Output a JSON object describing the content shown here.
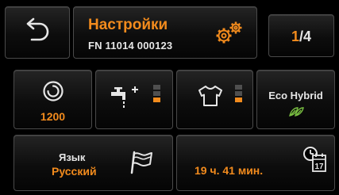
{
  "header": {
    "title": "Настройки",
    "subtitle": "FN 11014 000123",
    "back_icon": "back-arrow-icon",
    "settings_icon": "gears-icon"
  },
  "pagination": {
    "current": "1",
    "total": "/4"
  },
  "options": {
    "spin": {
      "value": "1200",
      "icon": "spin-icon"
    },
    "extra_water": {
      "icon": "tap-plus-icon",
      "level_bars_lit": 1,
      "level_bars_total": 3
    },
    "soil_level": {
      "icon": "shirt-icon",
      "level_bars_lit": 1,
      "level_bars_total": 3
    },
    "eco": {
      "label": "Eco Hybrid",
      "icon": "eco-leaf-icon"
    }
  },
  "language": {
    "label": "Язык",
    "value": "Русский",
    "icon": "flag-icon"
  },
  "timer": {
    "value": "19 ч. 41 мин.",
    "icon": "clock-calendar-icon",
    "calendar_day": "17"
  },
  "colors": {
    "accent": "#f28b1d",
    "text": "#e6e6e6",
    "eco_green": "#7bc142",
    "bar_off": "#4f4f4f"
  }
}
